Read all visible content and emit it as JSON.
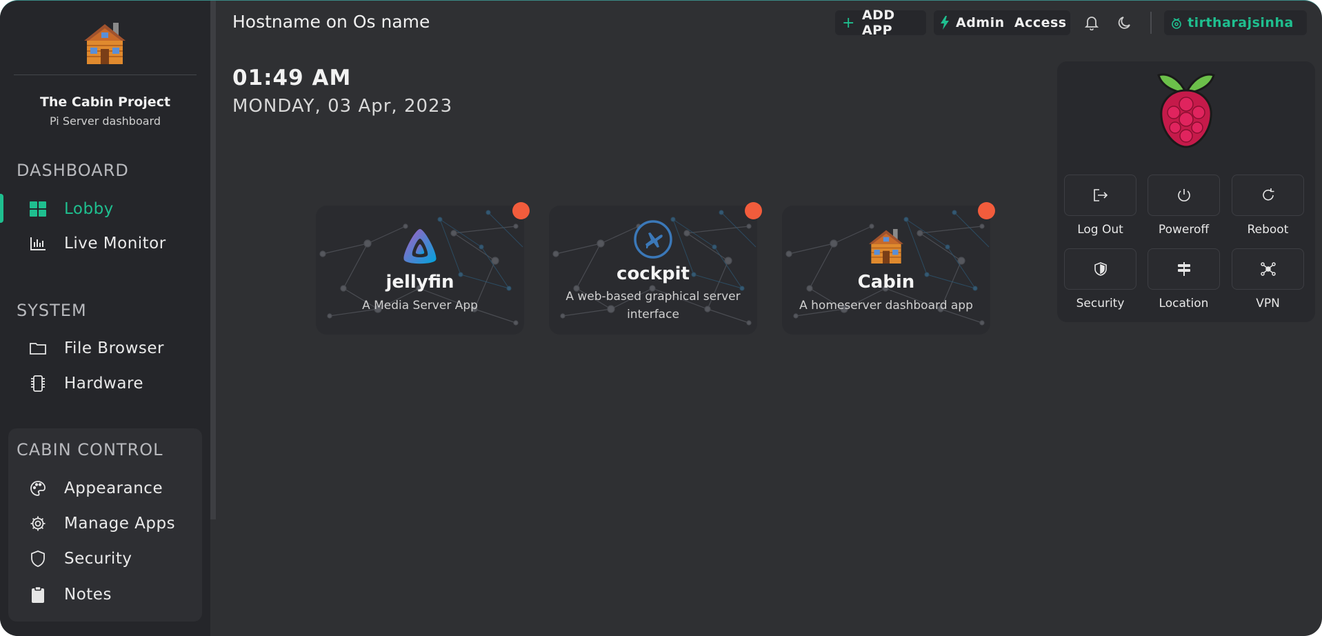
{
  "sidebar": {
    "brand_title": "The Cabin Project",
    "brand_subtitle": "Pi Server dashboard",
    "sections": {
      "dashboard": "DASHBOARD",
      "system": "SYSTEM",
      "cabin_control": "CABIN CONTROL"
    },
    "items": [
      {
        "label": "Lobby",
        "icon": "grid-icon",
        "active": true
      },
      {
        "label": "Live Monitor",
        "icon": "bar-chart-icon"
      },
      {
        "label": "File Browser",
        "icon": "folder-icon"
      },
      {
        "label": "Hardware",
        "icon": "chip-icon"
      },
      {
        "label": "Appearance",
        "icon": "palette-icon"
      },
      {
        "label": "Manage Apps",
        "icon": "gear-icon"
      },
      {
        "label": "Security",
        "icon": "shield-icon"
      },
      {
        "label": "Notes",
        "icon": "clipboard-icon"
      }
    ]
  },
  "header": {
    "hostname": "Hostname on Os name",
    "add_app": "ADD APP",
    "admin_access": "Admin  Access",
    "username": "tirtharajsinha"
  },
  "clock": {
    "time": "01:49 AM",
    "date": "MONDAY, 03 Apr, 2023"
  },
  "apps": [
    {
      "name": "jellyfin",
      "description": "A Media Server App",
      "status_color": "#f25c3c"
    },
    {
      "name": "cockpit",
      "description": "A web-based graphical server interface",
      "status_color": "#f25c3c"
    },
    {
      "name": "Cabin",
      "description": "A homeserver dashboard app",
      "status_color": "#f25c3c"
    }
  ],
  "power_panel": {
    "actions": [
      {
        "label": "Log Out",
        "icon": "logout-icon"
      },
      {
        "label": "Poweroff",
        "icon": "power-icon"
      },
      {
        "label": "Reboot",
        "icon": "refresh-icon"
      },
      {
        "label": "Security",
        "icon": "shield-icon"
      },
      {
        "label": "Location",
        "icon": "signpost-icon"
      },
      {
        "label": "VPN",
        "icon": "network-icon"
      }
    ]
  },
  "colors": {
    "accent": "#1fbf8f",
    "background": "#2f3033",
    "sidebar": "#25262a",
    "status_dot": "#f25c3c"
  }
}
